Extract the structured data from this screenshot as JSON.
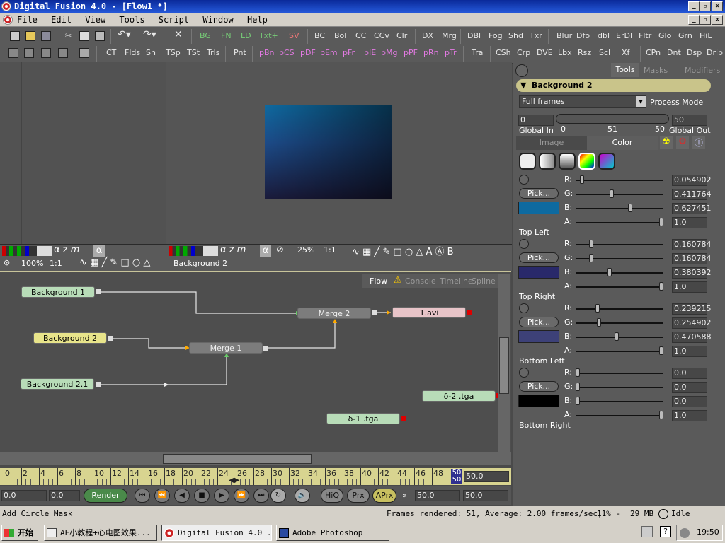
{
  "window": {
    "title": "Digital Fusion 4.0 - [Flow1 *]"
  },
  "menu": [
    "File",
    "Edit",
    "View",
    "Tools",
    "Script",
    "Window",
    "Help"
  ],
  "toolbar1": [
    "BG",
    "FN",
    "LD",
    "Txt+",
    "SV",
    "BC",
    "Bol",
    "CC",
    "CCv",
    "Clr",
    "DX",
    "Mrg",
    "DBl",
    "Fog",
    "Shd",
    "Txr",
    "Blur",
    "Dfo",
    "dbl",
    "ErDl",
    "Fltr",
    "Glo",
    "Grn",
    "HiL"
  ],
  "toolbar2": [
    "CT",
    "Flds",
    "Sh",
    "TSp",
    "TSt",
    "Trls",
    "Pnt",
    "pBn",
    "pCS",
    "pDF",
    "pEm",
    "pFr",
    "pIE",
    "pMg",
    "pPF",
    "pRn",
    "pTr",
    "Tra",
    "CSh",
    "Crp",
    "DVE",
    "Lbx",
    "Rsz",
    "Scl",
    "Xf",
    "CPn",
    "Dnt",
    "Dsp",
    "Drip"
  ],
  "viewer_left": {
    "zoom": "100%",
    "ratio": "1:1"
  },
  "viewer_right": {
    "zoom": "25%",
    "ratio": "1:1",
    "label": "Background 2"
  },
  "flow": {
    "tabs": [
      "Flow",
      "Console",
      "Timeline",
      "Spline"
    ],
    "nodes": {
      "bg1": "Background 1",
      "bg2": "Background 2",
      "bg21": "Background 2.1",
      "merge1": "Merge 1",
      "merge2": "Merge 2",
      "avi": "1.avi",
      "tga2": "δ-2 .tga",
      "tga1": "δ-1 .tga"
    }
  },
  "right": {
    "tabs": [
      "Tools",
      "Masks",
      "Modifiers"
    ],
    "tool_name": "Background 2",
    "frames": "Full frames",
    "process_mode": "Process Mode",
    "global_in": "0",
    "global_out": "50",
    "global_in_label": "Global In",
    "global_out_label": "Global Out",
    "range_ticks": [
      "0",
      "51",
      "50"
    ],
    "subtabs": [
      "Image",
      "Color"
    ],
    "pick": "Pick...",
    "channels": [
      "R:",
      "G:",
      "B:",
      "A:"
    ],
    "corners": [
      {
        "name": "Top Left",
        "color": "#0e6aa0",
        "values": [
          "0.054902",
          "0.411764",
          "0.627451",
          "1.0"
        ],
        "fractions": [
          0.055,
          0.41,
          0.63,
          1.0
        ]
      },
      {
        "name": "Top Right",
        "color": "#29296a",
        "values": [
          "0.160784",
          "0.160784",
          "0.380392",
          "1.0"
        ],
        "fractions": [
          0.16,
          0.16,
          0.38,
          1.0
        ]
      },
      {
        "name": "Bottom Left",
        "color": "#3d4178",
        "values": [
          "0.239215",
          "0.254902",
          "0.470588",
          "1.0"
        ],
        "fractions": [
          0.24,
          0.25,
          0.47,
          1.0
        ]
      },
      {
        "name": "Bottom Right",
        "color": "#000000",
        "values": [
          "0.0",
          "0.0",
          "0.0",
          "1.0"
        ],
        "fractions": [
          0.0,
          0.0,
          0.0,
          1.0
        ]
      }
    ]
  },
  "timeline": {
    "ticks": [
      "0",
      "2",
      "4",
      "6",
      "8",
      "10",
      "12",
      "14",
      "16",
      "18",
      "20",
      "22",
      "24",
      "26",
      "28",
      "30",
      "32",
      "34",
      "36",
      "38",
      "40",
      "42",
      "44",
      "46",
      "48"
    ],
    "end_top": "50",
    "end_bottom": "50",
    "end_value": "50.0"
  },
  "transport": {
    "start": "0.0",
    "current": "0.0",
    "render": "Render",
    "hiq": "HiQ",
    "prx": "Prx",
    "aprx": "APrx",
    "end": "50.0",
    "end2": "50.0"
  },
  "status": {
    "left": "Add Circle Mask",
    "frames": "Frames rendered: 51,  Average: 2.00 frames/sec,",
    "mem_pct": "11% -",
    "mem": "29 MB",
    "state": "Idle"
  },
  "taskbar": {
    "start": "开始",
    "tasks": [
      "AE小教程+心电图效果...",
      "Digital Fusion 4.0 ...",
      "Adobe Photoshop"
    ],
    "clock": "19:50"
  }
}
